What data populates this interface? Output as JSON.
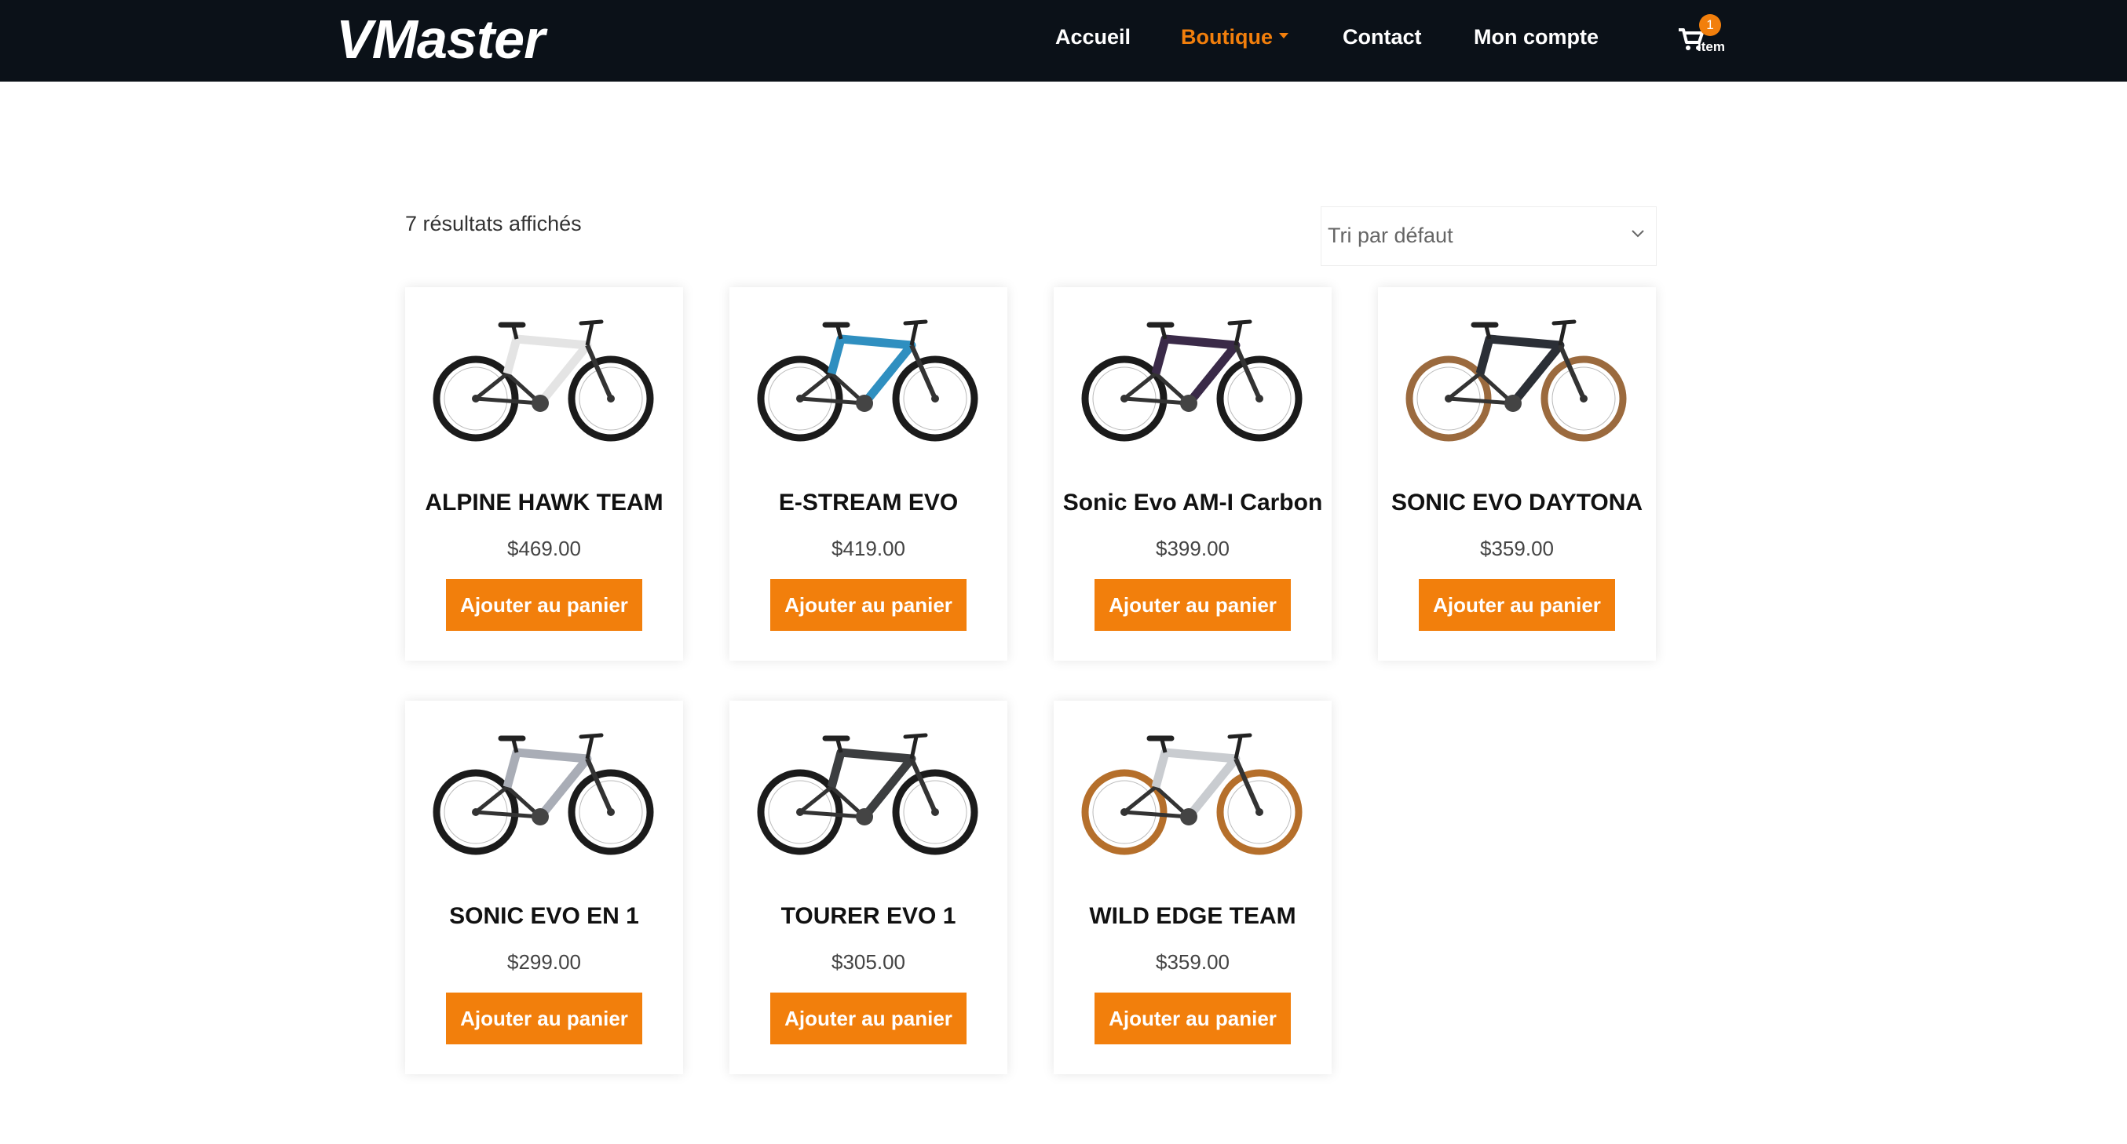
{
  "header": {
    "logo": "VMaster",
    "nav": [
      {
        "label": "Accueil",
        "active": false
      },
      {
        "label": "Boutique",
        "active": true
      },
      {
        "label": "Contact",
        "active": false
      },
      {
        "label": "Mon compte",
        "active": false
      }
    ],
    "cart": {
      "count": "1",
      "label": "Item",
      "icon": "cart-icon"
    }
  },
  "shop": {
    "results_text": "7 résultats affichés",
    "sort_label": "Tri par défaut",
    "products": [
      {
        "name": "ALPINE HAWK TEAM",
        "price": "$469.00",
        "button": "Ajouter au panier"
      },
      {
        "name": "E-STREAM EVO",
        "price": "$419.00",
        "button": "Ajouter au panier"
      },
      {
        "name": "Sonic Evo AM-I Carbon",
        "price": "$399.00",
        "button": "Ajouter au panier"
      },
      {
        "name": "SONIC EVO DAYTONA",
        "price": "$359.00",
        "button": "Ajouter au panier"
      },
      {
        "name": "SONIC EVO EN 1",
        "price": "$299.00",
        "button": "Ajouter au panier"
      },
      {
        "name": "TOURER EVO 1",
        "price": "$305.00",
        "button": "Ajouter au panier"
      },
      {
        "name": "WILD EDGE TEAM",
        "price": "$359.00",
        "button": "Ajouter au panier"
      }
    ]
  },
  "colors": {
    "accent": "#f27f0c",
    "header_bg": "#0b1118",
    "frame_colors": [
      "#e4e4e4",
      "#2f8fc0",
      "#3a2a48",
      "#2b2f36",
      "#a9adb6",
      "#3c3e40",
      "#c9ccd0"
    ],
    "tire_colors": [
      "#1b1b1b",
      "#1b1b1b",
      "#1b1b1b",
      "#9b6a3e",
      "#1b1b1b",
      "#1b1b1b",
      "#b56f2b"
    ]
  }
}
